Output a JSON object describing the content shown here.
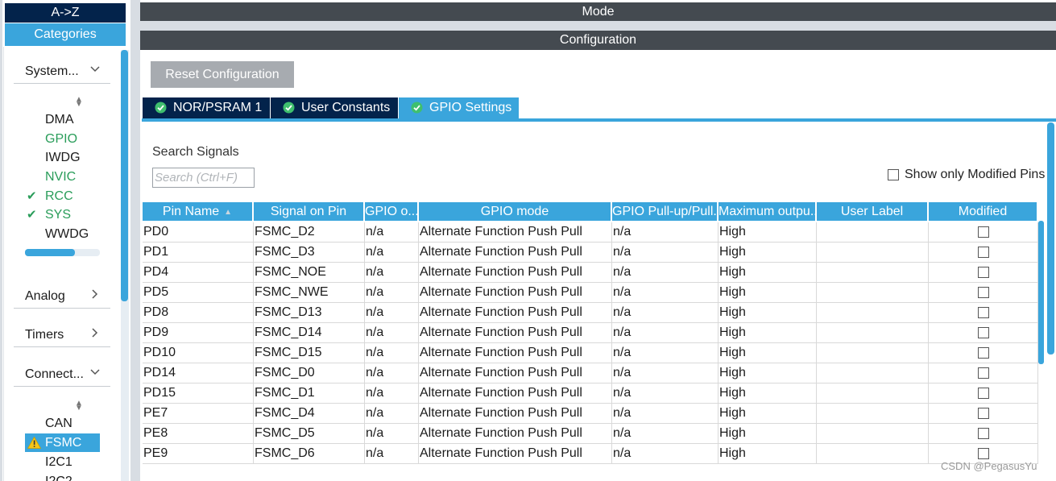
{
  "sidebar": {
    "tab_az": "A->Z",
    "tab_categories": "Categories",
    "sections": {
      "system": "System...",
      "analog": "Analog",
      "timers": "Timers",
      "connectivity": "Connect..."
    },
    "system_items": [
      {
        "label": "DMA",
        "color": "normal",
        "checked": false
      },
      {
        "label": "GPIO",
        "color": "green",
        "checked": false
      },
      {
        "label": "IWDG",
        "color": "normal",
        "checked": false
      },
      {
        "label": "NVIC",
        "color": "green",
        "checked": false
      },
      {
        "label": "RCC",
        "color": "green",
        "checked": true
      },
      {
        "label": "SYS",
        "color": "green",
        "checked": true
      },
      {
        "label": "WWDG",
        "color": "normal",
        "checked": false
      }
    ],
    "connectivity_items": [
      {
        "label": "CAN",
        "selected": false
      },
      {
        "label": "FSMC",
        "selected": true,
        "icon": "warning-icon"
      },
      {
        "label": "I2C1",
        "selected": false
      },
      {
        "label": "I2C2",
        "selected": false
      }
    ]
  },
  "header": {
    "mode": "Mode",
    "configuration": "Configuration"
  },
  "config": {
    "reset_label": "Reset Configuration",
    "tabs": [
      {
        "label": "NOR/PSRAM 1",
        "active": false
      },
      {
        "label": "User Constants",
        "active": false
      },
      {
        "label": "GPIO Settings",
        "active": true
      }
    ],
    "search_label": "Search Signals",
    "search_placeholder": "Search (Ctrl+F)",
    "search_value": "",
    "show_modified_label": "Show only Modified Pins",
    "show_modified_checked": false
  },
  "table": {
    "columns": [
      "Pin Name",
      "Signal on Pin",
      "GPIO o...",
      "GPIO mode",
      "GPIO Pull-up/Pull...",
      "Maximum outpu...",
      "User Label",
      "Modified"
    ],
    "rows": [
      [
        "PD0",
        "FSMC_D2",
        "n/a",
        "Alternate Function Push Pull",
        "n/a",
        "High",
        ""
      ],
      [
        "PD1",
        "FSMC_D3",
        "n/a",
        "Alternate Function Push Pull",
        "n/a",
        "High",
        ""
      ],
      [
        "PD4",
        "FSMC_NOE",
        "n/a",
        "Alternate Function Push Pull",
        "n/a",
        "High",
        ""
      ],
      [
        "PD5",
        "FSMC_NWE",
        "n/a",
        "Alternate Function Push Pull",
        "n/a",
        "High",
        ""
      ],
      [
        "PD8",
        "FSMC_D13",
        "n/a",
        "Alternate Function Push Pull",
        "n/a",
        "High",
        ""
      ],
      [
        "PD9",
        "FSMC_D14",
        "n/a",
        "Alternate Function Push Pull",
        "n/a",
        "High",
        ""
      ],
      [
        "PD10",
        "FSMC_D15",
        "n/a",
        "Alternate Function Push Pull",
        "n/a",
        "High",
        ""
      ],
      [
        "PD14",
        "FSMC_D0",
        "n/a",
        "Alternate Function Push Pull",
        "n/a",
        "High",
        ""
      ],
      [
        "PD15",
        "FSMC_D1",
        "n/a",
        "Alternate Function Push Pull",
        "n/a",
        "High",
        ""
      ],
      [
        "PE7",
        "FSMC_D4",
        "n/a",
        "Alternate Function Push Pull",
        "n/a",
        "High",
        ""
      ],
      [
        "PE8",
        "FSMC_D5",
        "n/a",
        "Alternate Function Push Pull",
        "n/a",
        "High",
        ""
      ],
      [
        "PE9",
        "FSMC_D6",
        "n/a",
        "Alternate Function Push Pull",
        "n/a",
        "High",
        ""
      ]
    ]
  },
  "watermark": "CSDN @PegasusYu",
  "colors": {
    "accent": "#3aa5dc",
    "dark_nav": "#03234b",
    "header_bar": "#444a50",
    "ok_green": "#2a9d5a",
    "warning": "#f5c518"
  }
}
